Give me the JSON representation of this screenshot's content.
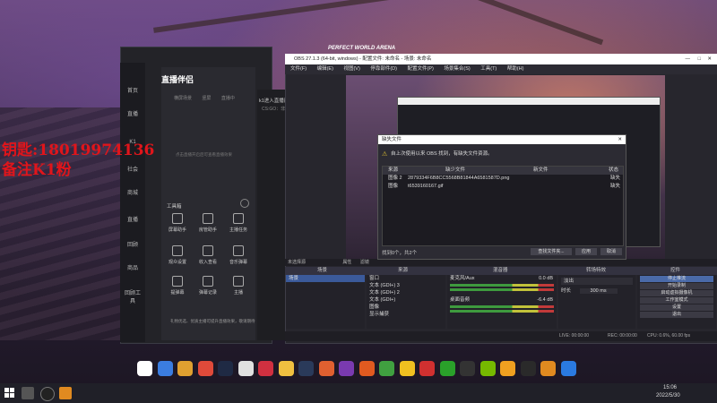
{
  "overlay": {
    "line1": "钥匙:18019974136",
    "line2": "备注K1粉"
  },
  "companion": {
    "brand": "直播伴侣",
    "tabs": [
      "横屏场景",
      "竖屏",
      "直播中"
    ],
    "empty_hint": "点击直播开启后可查看直播效果",
    "toolbox_title": "工具箱",
    "sidebar": [
      "首页",
      "直播",
      "K1",
      "社会",
      "商城",
      "直播",
      "回顾",
      "商品",
      "回顾工具"
    ],
    "tools": [
      {
        "label": "屏幕助手",
        "icon": "screen-icon"
      },
      {
        "label": "房管助手",
        "icon": "user-icon"
      },
      {
        "label": "主播任务",
        "icon": "task-icon"
      },
      {
        "label": "观众设置",
        "icon": "viewer-icon"
      },
      {
        "label": "收入查看",
        "icon": "income-icon"
      },
      {
        "label": "音乐弹幕",
        "icon": "music-icon"
      },
      {
        "label": "提弹幕",
        "icon": "danmaku-icon"
      },
      {
        "label": "弹幕记录",
        "icon": "record-icon"
      },
      {
        "label": "主播",
        "icon": "anchor-icon"
      }
    ],
    "notice": "礼物优选、优质主播可提升直播效果，敬请期待",
    "side_text": "k1进入直播间",
    "side_sub": "CS:GO：非"
  },
  "obs": {
    "title": "OBS 27.1.3 (64-bit, windows) - 配置文件: 未命名 - 场景: 未命名",
    "menu": [
      "文件(F)",
      "编辑(E)",
      "视图(V)",
      "停靠部件(D)",
      "配置文件(P)",
      "场景集合(S)",
      "工具(T)",
      "帮助(H)"
    ],
    "top_label": "PERFECT WORLD ARENA",
    "no_source": "未选择源",
    "props_btn": "属性",
    "filter_btn": "滤镜",
    "panels": {
      "scenes": "场景",
      "sources": "来源",
      "mixer": "混音器",
      "transitions": "转场特效",
      "controls": "控件"
    },
    "scenes": [
      "场景"
    ],
    "sources": [
      "窗口",
      "文本 (GDI+) 3",
      "文本 (GDI+) 2",
      "文本 (GDI+)",
      "图像",
      "显示捕获"
    ],
    "mixer": [
      {
        "name": "麦克风/Aux",
        "db": "0.0 dB"
      },
      {
        "name": "桌面音频",
        "db": "-6.4 dB"
      }
    ],
    "transition": {
      "type": "淡出",
      "duration_label": "时长",
      "duration": "300 ms"
    },
    "controls": [
      "停止推流",
      "开始录制",
      "启动虚拟摄像机",
      "工作室模式",
      "设置",
      "退出"
    ],
    "status": {
      "live": "LIVE: 00:00:00",
      "rec": "REC: 00:00:00",
      "cpu": "CPU: 0.6%, 60.00 fps"
    }
  },
  "dialog": {
    "title": "缺失文件",
    "message": "自上次使用以来 OBS 找到，有缺失文件资源。",
    "headers": [
      "来源",
      "缺少文件",
      "新文件",
      "状态"
    ],
    "rows": [
      {
        "source": "图像 2",
        "file": "2879334F6B8CC5568B81844A6581587D.png",
        "status": "缺失"
      },
      {
        "source": "图像",
        "file": "t6539160167.gif",
        "status": "缺失"
      }
    ],
    "footer": "找到0个，共2个",
    "buttons": [
      "查找文件夹...",
      "应用",
      "取消"
    ]
  },
  "taskbar": {
    "time": "15:06",
    "date": "2022/5/30"
  },
  "dock_icons": [
    "wallet-icon",
    "chart-icon",
    "folder-icon",
    "chrome-icon",
    "steam-icon",
    "photo-icon",
    "music-icon",
    "cat-icon",
    "steam2-icon",
    "game-icon",
    "app-icon",
    "game2-icon",
    "g-icon",
    "browser-icon",
    "netease-icon",
    "wechat-icon",
    "obs-icon",
    "nvidia-icon",
    "folder2-icon",
    "app2-icon",
    "file-icon",
    "k-icon"
  ],
  "dock_colors": [
    "#ffffff",
    "#3b7de0",
    "#e0a030",
    "#e04a3a",
    "#1f2a44",
    "#e0e0e0",
    "#d03040",
    "#f0c040",
    "#2a3a5a",
    "#e06030",
    "#7a3ab0",
    "#e05a20",
    "#40a040",
    "#f0c020",
    "#d03030",
    "#2aa02a",
    "#333333",
    "#76b900",
    "#f0a020",
    "#2a2a2a",
    "#e08a20",
    "#2a7ae0"
  ]
}
